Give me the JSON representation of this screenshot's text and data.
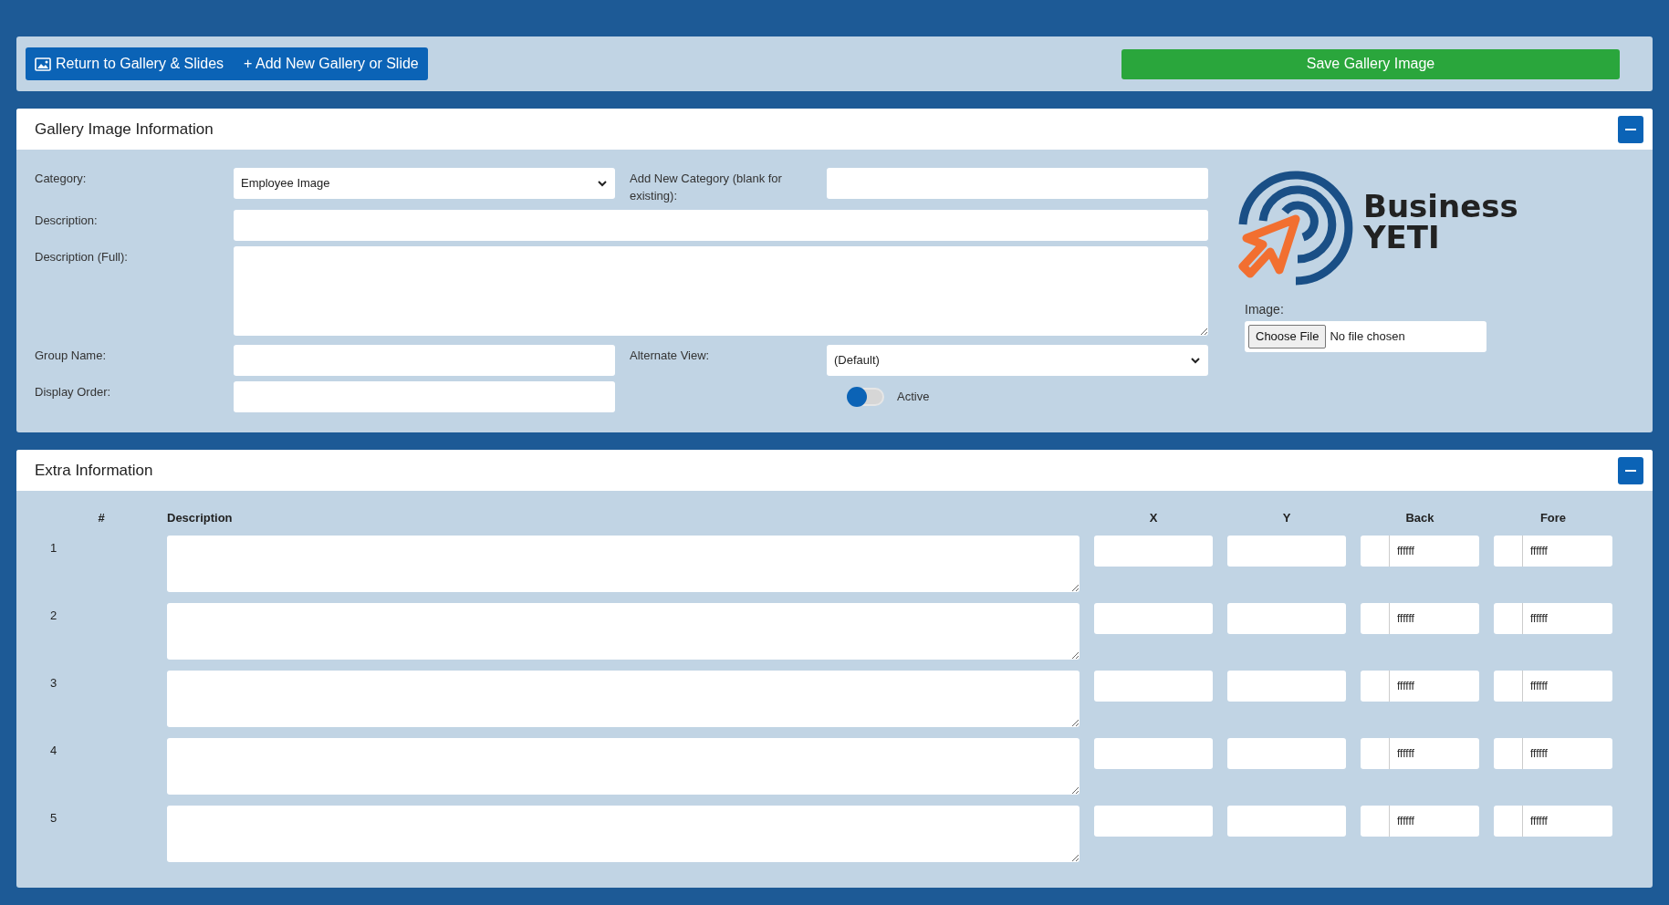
{
  "toolbar": {
    "buttons": [
      {
        "kind": "gallery",
        "label": "Return to Gallery & Slides"
      },
      {
        "kind": "add",
        "label": "+ Add New Gallery or Slide"
      }
    ],
    "save": "Save Gallery Image"
  },
  "info_panel": {
    "title": "Gallery Image Information",
    "expanded": true,
    "category": {
      "label": "Category:",
      "value": "Employee Image"
    },
    "new_category": {
      "label": "Add New Category (blank for existing):"
    },
    "description": {
      "label": "Description:"
    },
    "description_full": {
      "label": "Description (Full):"
    },
    "group_name": {
      "label": "Group Name:"
    },
    "alternate_view": {
      "label": "Alternate View:",
      "value": "(Default)"
    },
    "display_order": {
      "label": "Display Order:"
    },
    "active": {
      "label": "Active",
      "on": false
    },
    "logo": {
      "line1": "Business",
      "line2": "YETI"
    },
    "image": {
      "label": "Image:",
      "button": "Choose File",
      "status": "No file chosen"
    }
  },
  "extra_panel": {
    "title": "Extra Information",
    "expanded": true,
    "columns": [
      "#",
      "Description",
      "X",
      "Y",
      "Back",
      "Fore"
    ],
    "rows": [
      {
        "number": "1",
        "back": "ffffff",
        "fore": "ffffff"
      },
      {
        "number": "2",
        "back": "ffffff",
        "fore": "ffffff"
      },
      {
        "number": "3",
        "back": "ffffff",
        "fore": "ffffff"
      },
      {
        "number": "4",
        "back": "ffffff",
        "fore": "ffffff"
      },
      {
        "number": "5",
        "back": "ffffff",
        "fore": "ffffff"
      }
    ]
  }
}
